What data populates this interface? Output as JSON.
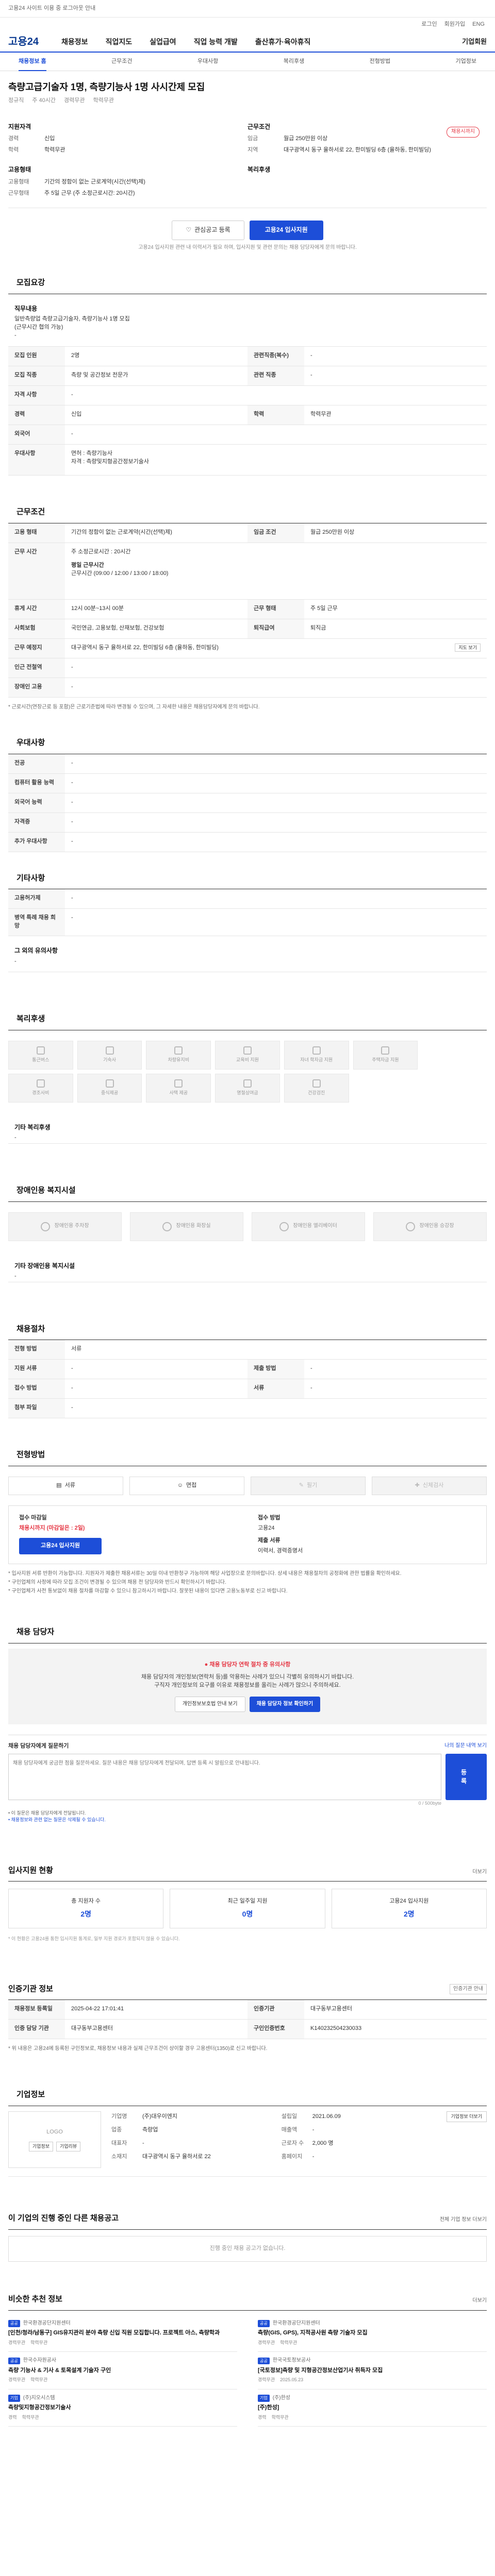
{
  "topbar": {
    "text": "고용24 사이트 이용 중 로그아웃 안내",
    "right": ""
  },
  "toplinks": [
    "로그인",
    "회원가입",
    "ENG"
  ],
  "brand": {
    "logo": "고용24",
    "nav": [
      "채용정보",
      "직업지도",
      "실업급여",
      "직업 능력 개발",
      "출산휴가·육아휴직"
    ],
    "nav_right": "기업회원"
  },
  "subnav": {
    "items": [
      "채용정보 홈",
      "근무조건",
      "우대사항",
      "복리후생",
      "전형방법",
      "기업정보"
    ]
  },
  "job": {
    "company_label": "",
    "title": "측량고급기술자 1명, 측량기능사 1명 사시간제 모집",
    "chips": [
      "정규직",
      "주 40시간",
      "경력무관",
      "학력무관"
    ],
    "badge": "채용시까지",
    "left_title": "지원자격",
    "right_title": "근무조건",
    "left": [
      {
        "k": "경력",
        "v": "신입"
      },
      {
        "k": "학력",
        "v": "학력무관"
      }
    ],
    "right": [
      {
        "k": "임금",
        "v": "월급 250만원 이상"
      },
      {
        "k": "지역",
        "v": "대구광역시 동구 율하서로 22, 한미빌딩 6층 (율하동, 한미빌딩)"
      }
    ],
    "left2_title": "고용형태",
    "left2": [
      {
        "k": "고용형태",
        "v": "기간의 정함이 없는 근로계약(시간(선택)제)"
      },
      {
        "k": "근무형태",
        "v": "주 5일 근무 (주 소정근로시간: 20시간)"
      }
    ],
    "right2_title": "복리후생",
    "right2": []
  },
  "actions": {
    "scrap": "관심공고 등록",
    "apply": "고용24 입사지원",
    "hint": "고용24 입사지원 관련 내 이력서가 필요 하며, 입사지원 및 관련 문의는 채용 담당자에게 문의 바랍니다."
  },
  "sec_recruit": {
    "title": "모집요강",
    "duty_title": "직무내용",
    "duty": [
      "일반측량업 측량고급기술자, 측량기능사 1명 모집 ",
      "(근무시간 협의 가능)",
      "-"
    ],
    "rows": [
      {
        "k": "모집 인원",
        "v": "2명",
        "k2": "관련직종(복수)",
        "v2": "-"
      },
      {
        "k": "모집 직종",
        "v": "측량 및 공간정보 전문가",
        "k2": "관련 직종",
        "v2": "-"
      },
      {
        "k": "자격 사항",
        "v": "-",
        "k2": "",
        "v2": ""
      },
      {
        "k": "경력",
        "v": "신입",
        "k2": "학력",
        "v2": "학력무관"
      },
      {
        "k": "외국어",
        "v": "-",
        "k2": "",
        "v2": ""
      },
      {
        "k": "우대사항",
        "v": "면허 : 측량기능사",
        "k2": "",
        "v2": ""
      },
      {
        "k": "",
        "v": "자격 : 측량및지형공간정보기술사",
        "k2": "",
        "v2": ""
      }
    ]
  },
  "sec_cond": {
    "title": "근무조건",
    "rows": [
      {
        "k": "고용 형태",
        "v": "기간의 정함이 없는 근로계약(시간(선택)제)",
        "k2": "임금 조건",
        "v2": "월급 250만원 이상"
      },
      {
        "k": "근무 시간",
        "v": "주 소정근로시간 : 20시간",
        "k2": "",
        "v2": ""
      },
      {
        "k": "",
        "v": "평일 근무시간",
        "k2": "",
        "v2": ""
      },
      {
        "k": "",
        "v": "근무시간 (09:00 / 12:00 / 13:00 / 18:00)",
        "k2": "",
        "v2": ""
      },
      {
        "k": "휴게 시간",
        "v": "12시 00분~13시 00분",
        "k2": "근무 형태",
        "v2": "주 5일 근무"
      },
      {
        "k": "사회보험",
        "v": "국민연금, 고용보험, 산재보험, 건강보험",
        "k2": "퇴직급여",
        "v2": "퇴직금"
      },
      {
        "k": "근무 예정지",
        "v": "대구광역시 동구 율하서로 22, 한미빌딩 6층 (율하동, 한미빌딩)",
        "k2": "지도 보기",
        "v2": ""
      },
      {
        "k": "인근 전철역",
        "v": "-",
        "k2": "",
        "v2": ""
      },
      {
        "k": "장애인 고용",
        "v": "-",
        "k2": "",
        "v2": ""
      }
    ],
    "note": "* 근로시간(연장근로 등 포함)은 근로기준법에 따라 변경될 수 있으며, 그 자세한 내용은 채용담당자에게 문의 바랍니다."
  },
  "sec_pref": {
    "title": "우대사항",
    "rows": [
      {
        "k": "전공",
        "v": "-"
      },
      {
        "k": "컴퓨터 활용 능력",
        "v": "-"
      },
      {
        "k": "외국어 능력",
        "v": "-"
      },
      {
        "k": "자격증",
        "v": "-"
      },
      {
        "k": "추가 우대사항",
        "v": "-"
      }
    ]
  },
  "sec_etc": {
    "title": "기타사항",
    "rows": [
      {
        "k": "고용허가제",
        "v": "-"
      },
      {
        "k": "병역 특례 채용 희망",
        "v": "-"
      }
    ],
    "extra_title": "그 외의 유의사항",
    "extra": "-"
  },
  "sec_welfare": {
    "title": "복리후생",
    "cards": [
      "통근버스",
      "기숙사",
      "차량유지비",
      "교육비 지원",
      "자녀 학자금 지원",
      "주택자금 지원",
      "경조사비",
      "중식제공",
      "사택 제공",
      "명절상여금",
      "건강검진",
      "체력단련비",
      "-",
      "-"
    ],
    "extra_title": "기타 복리후생",
    "extra": "-"
  },
  "sec_disab": {
    "title": "장애인용 복지시설",
    "cards": [
      "장애인용 주차장",
      "장애인용 화장실",
      "장애인용 엘리베이터",
      "장애인용 승강장"
    ],
    "extra_title": "기타 장애인용 복지시설",
    "extra": "-"
  },
  "sec_proc": {
    "title": "채용절차",
    "rows": [
      {
        "k": "전형 방법",
        "v": "서류",
        "k2": "",
        "v2": ""
      },
      {
        "k": "지원 서류",
        "v": "-",
        "k2": "제출 방법",
        "v2": "-"
      },
      {
        "k": "접수 방법",
        "v": "-",
        "k2": "서류",
        "v2": "-"
      },
      {
        "k": "첨부 파일",
        "v": "-",
        "k2": "",
        "v2": ""
      }
    ]
  },
  "sec_method": {
    "title": "전형방법",
    "methods": [
      "서류",
      "면접",
      "필기",
      "신체검사"
    ],
    "deadline_label": "접수 마감일",
    "deadline": "채용시까지 (마감일은 : 2일)",
    "apply_btn": "고용24 입사지원",
    "method_label": "접수 방법",
    "method_val": "고용24",
    "method2_label": "제출 서류",
    "method2_val": "이력서, 경력증명서",
    "notes": [
      "* 입사지원 서류 반환이 가능합니다. 지원자가 제출한 채용서류는 30일 이내 반환청구 가능하며 해당 사업장으로 문의바랍니다. 상세 내용은 채용절차의 공정화에 관한 법률을 확인하세요.",
      "* 구인업체의 사정에 따라 모집 조건이 변경될 수 있으며 채용 전 담당자와 반드시 확인하시기 바랍니다.",
      "* 구인업체가 사전 통보없이 채용 절차를 마감할 수 있으니 참고하시기 바랍니다. 잘못된 내용이 있다면 고용노동부로 신고 바랍니다."
    ]
  },
  "sec_contact": {
    "title": "채용 담당자",
    "warn_title": "채용 담당자 연락 절차 중 유의사항",
    "warn": [
      "채용 담당자의 개인정보(연락처 등)를 악용하는 사례가 있으니 각별히 유의하시기 바랍니다.",
      "구직자 개인정보의 요구를 이유로 채용정보를 올리는 사례가 많으니 주의하세요."
    ],
    "btn1": "개인정보보호법 안내 보기",
    "btn2": "채용 담당자 정보 확인하기"
  },
  "qna": {
    "label": "채용 담당자에게 질문하기",
    "link": "나의 질문 내역 보기",
    "placeholder": "채용 담당자에게 궁금한 점을 질문하세요. 질문 내용은 채용 담당자에게 전달되며, 답변 등록 시 알림으로 안내됩니다.",
    "counter": "0 / 500byte",
    "submit": "등록",
    "notes": [
      "• 이 질문은 채용 담당자에게 전달됩니다.",
      "• 채용정보와 관련 없는 질문은 삭제될 수 있습니다."
    ]
  },
  "sec_stats": {
    "title": "입사지원 현황",
    "more": "더보기",
    "stats": [
      {
        "k": "총 지원자 수",
        "v": "2명"
      },
      {
        "k": "최근 일주일 지원",
        "v": "0명"
      },
      {
        "k": "고용24 입사지원",
        "v": "2명"
      }
    ],
    "note": "* 이 현황은 고용24를 통한 입사지원 통계로, 일부 지원 경로가 포함되지 않을 수 있습니다."
  },
  "sec_cert": {
    "title": "인증기관 정보",
    "more": "인증기관 안내",
    "rows": [
      {
        "k": "채용정보 등록일",
        "v": "2025-04-22 17:01:41",
        "k2": "인증기관",
        "v2": "대구동부고용센터"
      },
      {
        "k": "인증 담당 기관",
        "v": "대구동부고용센터",
        "k2": "구인인증번호",
        "v2": "K140232504230033"
      }
    ],
    "note": "* 위 내용은 고용24에 등록된 구인정보로, 채용정보 내용과 실제 근무조건이 상이할 경우 고용센터(1350)로 신고 바랍니다."
  },
  "sec_company": {
    "title": "기업정보",
    "logo_text": "LOGO",
    "btns": [
      "기업정보",
      "기업리뷰"
    ],
    "rows": [
      {
        "k": "기업명",
        "v": "(주)대우이엔지"
      },
      {
        "k": "업종",
        "v": "측량업"
      },
      {
        "k": "설립일",
        "v": "2021.06.09"
      },
      {
        "k": "매출액",
        "v": "-"
      },
      {
        "k": "대표자",
        "v": "-"
      },
      {
        "k": "근로자 수",
        "v": "2,000 명"
      },
      {
        "k": "소재지",
        "v": "대구광역시 동구 율하서로 22"
      },
      {
        "k": "홈페이지",
        "v": "-"
      }
    ],
    "right_btn": "기업정보 더보기"
  },
  "sec_other": {
    "title": "이 기업의 진행 중인 다른 채용공고",
    "more": "전체 기업 정보 더보기",
    "empty": "진행 중인 채용 공고가 없습니다."
  },
  "sec_reco": {
    "title": "비슷한 추천 정보",
    "more": "더보기",
    "jobs": [
      {
        "co": "한국환경공단지원센터",
        "tag": "공공",
        "title": "[인천/청라/남동구] GIS유지관리 분야 측량 신입 직원 모집합니다. 프로젝트 아스, 측량학과",
        "meta": [
          "경력무관",
          "학력무관"
        ]
      },
      {
        "co": "한국환경공단지원센터",
        "tag": "공공",
        "title": "측량(GIS, GPS), 지적공사원 측량 기술자 모집",
        "meta": [
          "경력무관",
          "학력무관"
        ]
      },
      {
        "co": "한국수자원공사",
        "tag": "공공",
        "title": "측량 기능사 & 기사 & 토목설계 기술자 구인",
        "meta": [
          "경력무관",
          "학력무관"
        ]
      },
      {
        "co": "한국국토정보공사",
        "tag": "공공",
        "title": "[국토정보]측량 및 지형공간정보산업기사 취득자 모집",
        "meta": [
          "경력무관",
          "2025.05.23"
        ]
      },
      {
        "co": "(주)지오시스템",
        "tag": "기업",
        "title": "측량및지형공간정보기술사",
        "meta": [
          "경력",
          "학력무관"
        ]
      },
      {
        "co": "(주)한성",
        "tag": "기업",
        "title": "[주)한성]",
        "meta": [
          "경력",
          "학력무관"
        ]
      }
    ]
  }
}
